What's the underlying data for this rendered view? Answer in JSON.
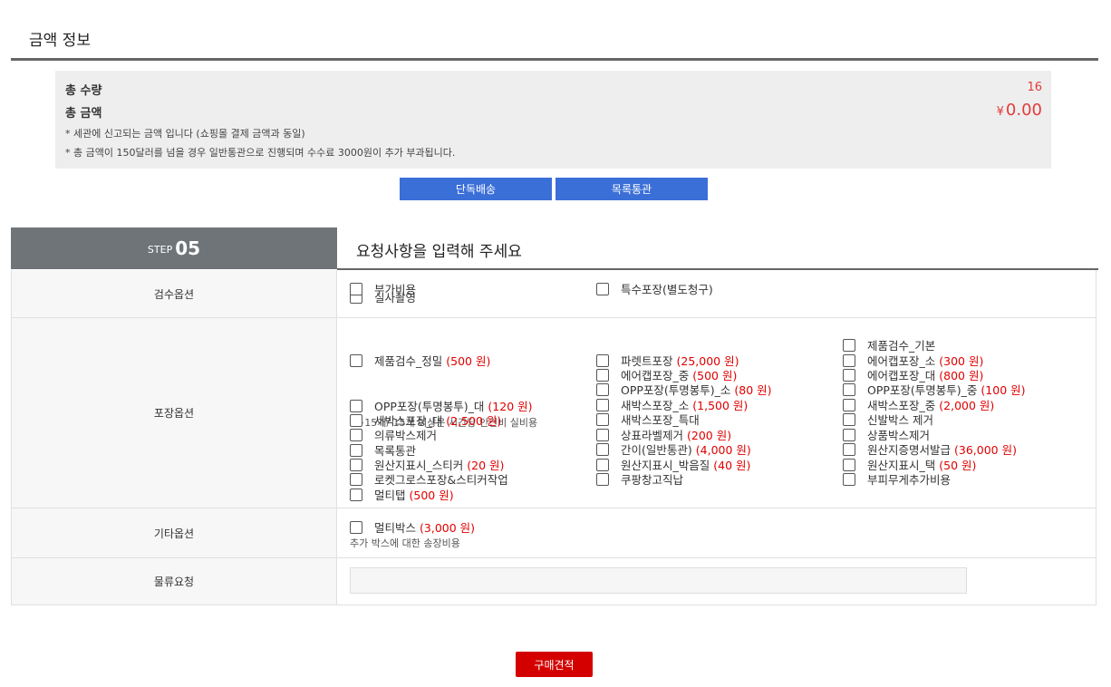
{
  "section_title": "금액 정보",
  "summary": {
    "qty_label": "총 수량",
    "qty_value": "16",
    "amount_label": "총 금액",
    "currency_symbol": "¥",
    "amount_value": "0.00",
    "note1": "* 세관에 신고되는 금액 입니다 (쇼핑몰 결제 금액과 동일)",
    "note2": "* 총 금액이 150달러를 넘을 경우 일반통관으로 진행되며 수수료 3000원이 추가 부과됩니다."
  },
  "shipping_buttons": [
    "단독배송",
    "목록통관"
  ],
  "step": {
    "word": "STEP",
    "number": "05",
    "title": "요청사항을 입력해 주세요"
  },
  "rows": {
    "inspection": {
      "label": "검수옵션",
      "items": [
        {
          "name": "실사촬영",
          "price": ""
        }
      ]
    },
    "packing": {
      "label": "포장옵션",
      "col1": [
        {
          "name": "부가비용",
          "price": ""
        },
        {
          "name": "제품검수_정밀",
          "price": "(500 원)"
        },
        {
          "name": "OPP포장(투명봉투)_대",
          "price": "(120 원)"
        },
        {
          "name": "새박스포장_대",
          "price": "(2,500 원)"
        },
        {
          "name": "의류박스제거",
          "price": ""
        },
        {
          "name": "목록통관",
          "price": ""
        },
        {
          "name": "원산지표시_스티커",
          "price": "(20 원)"
        },
        {
          "name": "로켓그로스포장&스티커작업",
          "price": ""
        },
        {
          "name": "멀티탭",
          "price": "(500 원)"
        }
      ],
      "col1_note": "1~15개/ 15개 이상은 시간당 인건비 실비용",
      "col2": [
        {
          "name": "특수포장(별도청구)",
          "price": ""
        },
        {
          "name": "파렛트포장",
          "price": "(25,000 원)"
        },
        {
          "name": "에어캡포장_중",
          "price": "(500 원)"
        },
        {
          "name": "OPP포장(투명봉투)_소",
          "price": "(80 원)"
        },
        {
          "name": "새박스포장_소",
          "price": "(1,500 원)"
        },
        {
          "name": "새박스포장_특대",
          "price": ""
        },
        {
          "name": "상표라벨제거",
          "price": "(200 원)"
        },
        {
          "name": "간이(일반통관)",
          "price": "(4,000 원)"
        },
        {
          "name": "원산지표시_박음질",
          "price": "(40 원)"
        },
        {
          "name": "쿠팡창고직납",
          "price": ""
        }
      ],
      "col3": [
        {
          "name": "제품검수_기본",
          "price": ""
        },
        {
          "name": "에어캡포장_소",
          "price": "(300 원)"
        },
        {
          "name": "에어캡포장_대",
          "price": "(800 원)"
        },
        {
          "name": "OPP포장(투명봉투)_중",
          "price": "(100 원)"
        },
        {
          "name": "새박스포장_중",
          "price": "(2,000 원)"
        },
        {
          "name": "신발박스 제거",
          "price": ""
        },
        {
          "name": "상품박스제거",
          "price": ""
        },
        {
          "name": "원산지증명서발급",
          "price": "(36,000 원)"
        },
        {
          "name": "원산지표시_택",
          "price": "(50 원)"
        },
        {
          "name": "부피무게추가비용",
          "price": ""
        }
      ]
    },
    "other": {
      "label": "기타옵션",
      "items": [
        {
          "name": "멀티박스",
          "price": "(3,000 원)"
        }
      ],
      "note": "추가 박스에 대한 송장비용"
    },
    "logistics": {
      "label": "물류요청",
      "input_value": "",
      "input_placeholder": ""
    }
  },
  "quote_button": "구매견적"
}
